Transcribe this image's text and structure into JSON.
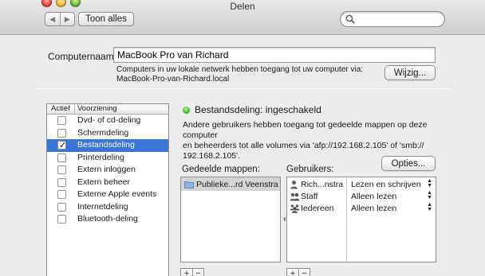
{
  "window": {
    "title": "Delen"
  },
  "toolbar": {
    "back_icon": "chevron-left-icon",
    "forward_icon": "chevron-right-icon",
    "show_all_label": "Toon alles",
    "search_placeholder": ""
  },
  "computer": {
    "name_label": "Computernaam:",
    "name_value": "MacBook Pro van Richard",
    "desc_line1": "Computers in uw lokale netwerk hebben toegang tot uw computer via:",
    "desc_line2": "MacBook-Pro-van-Richard.local",
    "edit_button": "Wijzig..."
  },
  "services": {
    "col_active": "Actief",
    "col_service": "Voorziening",
    "items": [
      {
        "label": "Dvd- of cd-deling",
        "checked": false,
        "selected": false
      },
      {
        "label": "Schermdeling",
        "checked": false,
        "selected": false
      },
      {
        "label": "Bestandsdeling",
        "checked": true,
        "selected": true
      },
      {
        "label": "Printerdeling",
        "checked": false,
        "selected": false
      },
      {
        "label": "Extern inloggen",
        "checked": false,
        "selected": false
      },
      {
        "label": "Extern beheer",
        "checked": false,
        "selected": false
      },
      {
        "label": "Externe Apple events",
        "checked": false,
        "selected": false
      },
      {
        "label": "Internetdeling",
        "checked": false,
        "selected": false
      },
      {
        "label": "Bluetooth-deling",
        "checked": false,
        "selected": false
      }
    ]
  },
  "detail": {
    "status": "Bestandsdeling: ingeschakeld",
    "status_color": "#3fbb2a",
    "desc_line1": "Andere gebruikers hebben toegang tot gedeelde mappen op deze computer",
    "desc_line2": "en beheerders tot alle volumes via 'afp://192.168.2.105' of 'smb://",
    "desc_line3": "192.168.2.105'.",
    "options_button": "Opties...",
    "shared_folders_label": "Gedeelde mappen:",
    "users_label": "Gebruikers:",
    "folders": [
      {
        "name": "Publieke...rd Veenstra",
        "icon": "folder-icon"
      }
    ],
    "users": [
      {
        "name": "Rich...nstra",
        "permission": "Lezen en schrijven",
        "icon": "user-icon"
      },
      {
        "name": "Staff",
        "permission": "Alleen lezen",
        "icon": "group-icon"
      },
      {
        "name": "Iedereen",
        "permission": "Alleen lezen",
        "icon": "everyone-icon"
      }
    ],
    "add_label": "+",
    "remove_label": "−"
  },
  "colors": {
    "selection": "#3875d7"
  }
}
